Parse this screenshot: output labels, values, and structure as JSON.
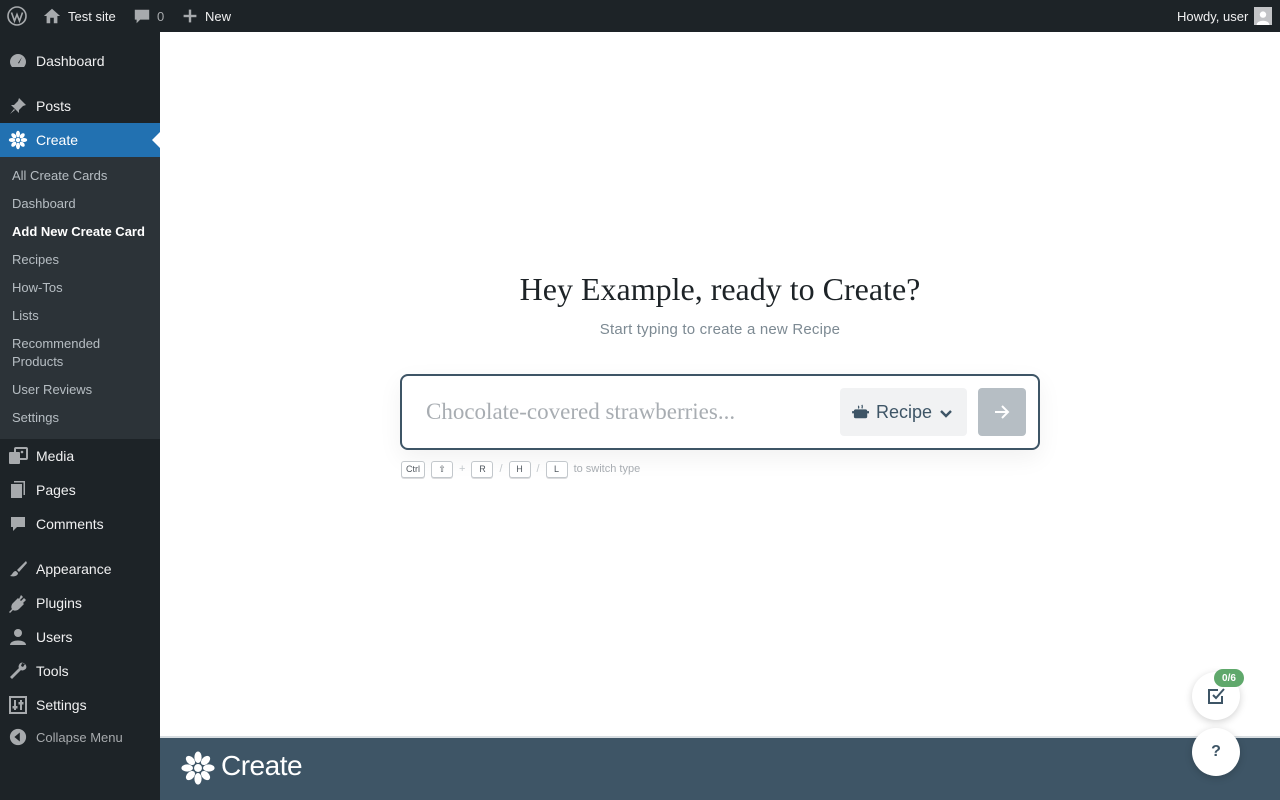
{
  "adminbar": {
    "site_name": "Test site",
    "comments_count": "0",
    "new_label": "New",
    "greeting": "Howdy, user"
  },
  "sidebar": {
    "items": [
      {
        "label": "Dashboard",
        "icon": "dashboard-icon"
      },
      {
        "label": "Posts",
        "icon": "pin-icon"
      },
      {
        "label": "Create",
        "icon": "create-flower-icon"
      },
      {
        "label": "Media",
        "icon": "media-icon"
      },
      {
        "label": "Pages",
        "icon": "pages-icon"
      },
      {
        "label": "Comments",
        "icon": "comment-icon"
      },
      {
        "label": "Appearance",
        "icon": "brush-icon"
      },
      {
        "label": "Plugins",
        "icon": "plugin-icon"
      },
      {
        "label": "Users",
        "icon": "user-icon"
      },
      {
        "label": "Tools",
        "icon": "wrench-icon"
      },
      {
        "label": "Settings",
        "icon": "sliders-icon"
      }
    ],
    "submenu": [
      "All Create Cards",
      "Dashboard",
      "Add New Create Card",
      "Recipes",
      "How-Tos",
      "Lists",
      "Recommended Products",
      "User Reviews",
      "Settings"
    ],
    "collapse_label": "Collapse Menu"
  },
  "main": {
    "heading": "Hey Example, ready to Create?",
    "subheading": "Start typing to create a new Recipe",
    "input_placeholder": "Chocolate-covered strawberries...",
    "type_label": "Recipe",
    "hint": {
      "keys": [
        "Ctrl",
        "⇧",
        "R",
        "H",
        "L"
      ],
      "plus": "+",
      "slash": "/",
      "text": "to switch type"
    }
  },
  "footer": {
    "logo_text": "Create"
  },
  "floating": {
    "checklist_badge": "0/6",
    "help_label": "?"
  },
  "colors": {
    "admin_dark": "#1d2327",
    "submenu_bg": "#2c3338",
    "wp_blue": "#2271b1",
    "create_slate": "#3e5566",
    "badge_green": "#5fa86b"
  }
}
